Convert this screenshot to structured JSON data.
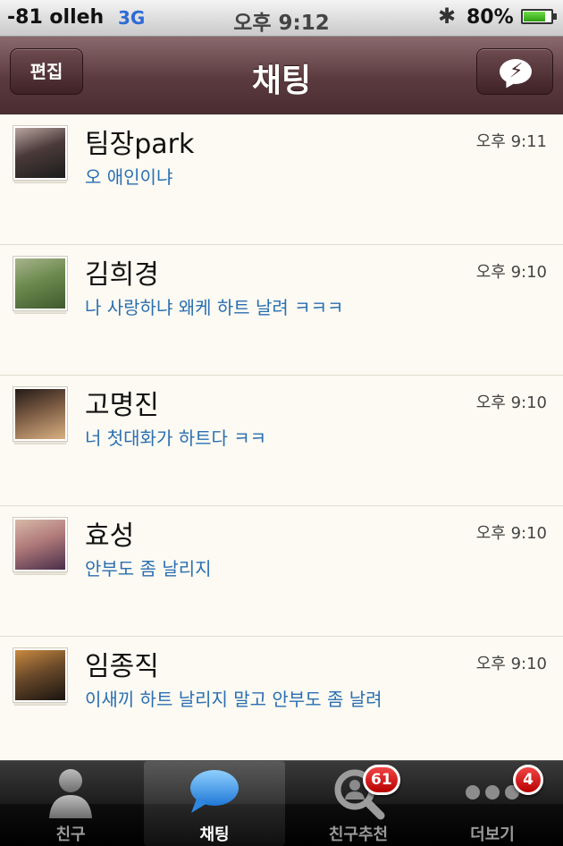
{
  "status_bar": {
    "signal": "-81",
    "carrier": "olleh",
    "network": "3G",
    "time": "오후 9:12",
    "battery": "80%",
    "battery_level": 0.8
  },
  "nav": {
    "title": "채팅",
    "edit_label": "편집",
    "new_chat_icon": "new-chat-icon"
  },
  "chats": [
    {
      "name": "팀장park",
      "message": "오 애인이냐",
      "time": "오후 9:11",
      "avatar_colors": [
        "#1c1c1c",
        "#4b3a3a",
        "#b9a6a0"
      ]
    },
    {
      "name": "김희경",
      "message": "나 사랑하냐 왜케 하트 날려 ㅋㅋㅋ",
      "time": "오후 9:10",
      "avatar_colors": [
        "#3f5a2e",
        "#6c8a4f",
        "#a8b38d"
      ]
    },
    {
      "name": "고명진",
      "message": "너 첫대화가 하트다 ㅋㅋ",
      "time": "오후 9:10",
      "avatar_colors": [
        "#d9b082",
        "#7a5a42",
        "#231a17"
      ]
    },
    {
      "name": "효성",
      "message": "안부도 좀 날리지",
      "time": "오후 9:10",
      "avatar_colors": [
        "#4a2e4a",
        "#b07a7a",
        "#d8b9a8"
      ]
    },
    {
      "name": "임종직",
      "message": "이새끼 하트 날리지 말고 안부도 좀 날려",
      "time": "오후 9:10",
      "avatar_colors": [
        "#1a1410",
        "#6b4a2a",
        "#c98a40"
      ]
    }
  ],
  "tabs": [
    {
      "label": "친구",
      "icon": "person-icon",
      "badge": ""
    },
    {
      "label": "채팅",
      "icon": "chat-bubble-icon",
      "badge": ""
    },
    {
      "label": "친구추천",
      "icon": "magnifier-person-icon",
      "badge": "61"
    },
    {
      "label": "더보기",
      "icon": "more-dots-icon",
      "badge": "4"
    }
  ],
  "colors": {
    "nav_bar": "#5a3a3e",
    "message_text": "#2a6fb2",
    "list_background": "#fcfaf2",
    "badge": "#d11414"
  }
}
